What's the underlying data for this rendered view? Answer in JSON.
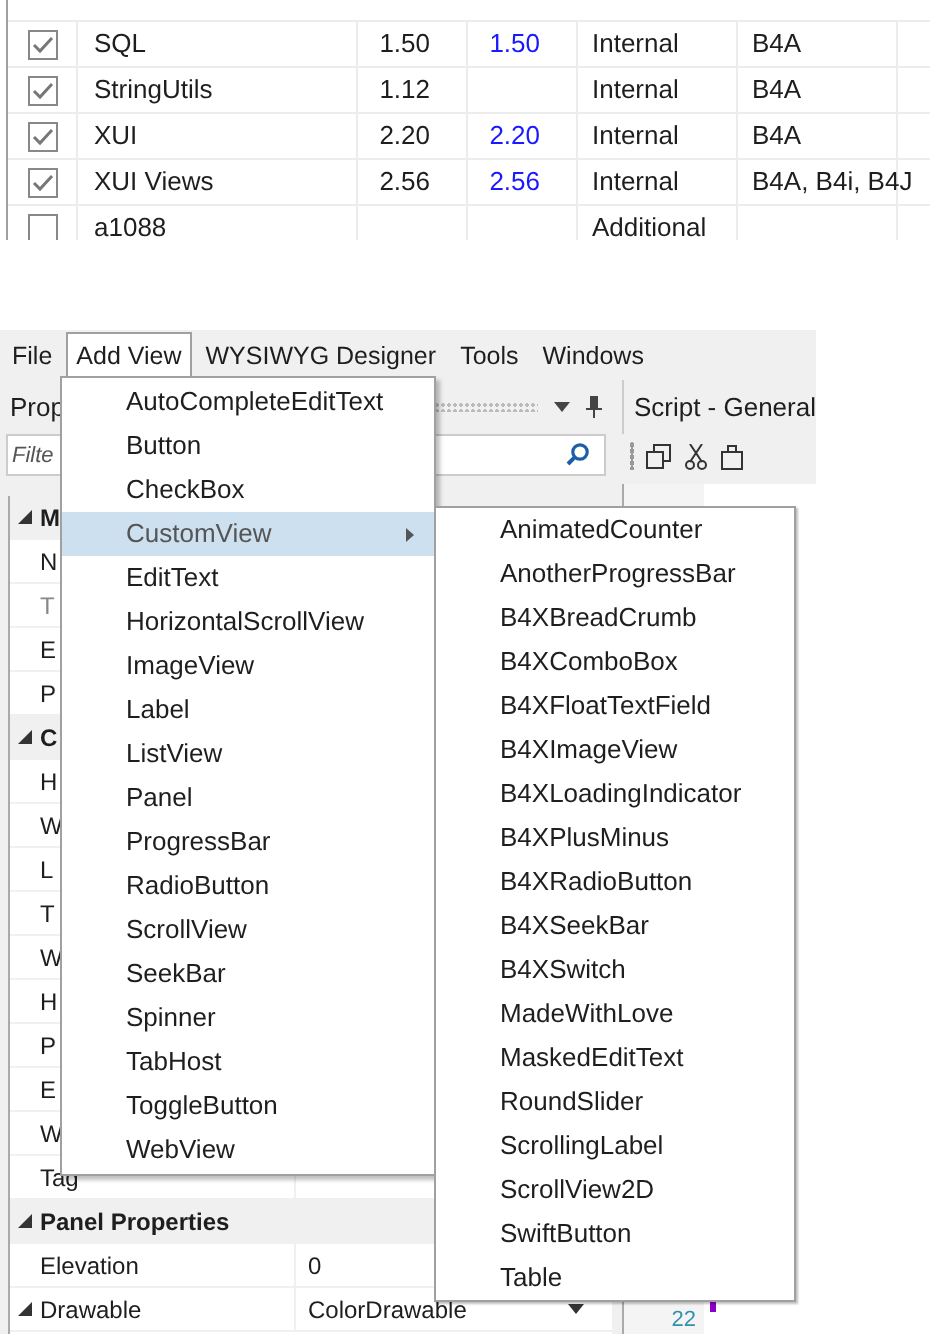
{
  "library_table": {
    "rows": [
      {
        "checked": true,
        "name": "SQL",
        "version": "1.50",
        "online_version": "1.50",
        "type": "Internal",
        "platforms": "B4A"
      },
      {
        "checked": true,
        "name": "StringUtils",
        "version": "1.12",
        "type": "Internal",
        "platforms": "B4A"
      },
      {
        "checked": true,
        "name": "XUI",
        "version": "2.20",
        "online_version": "2.20",
        "type": "Internal",
        "platforms": "B4A"
      },
      {
        "checked": true,
        "name": "XUI Views",
        "version": "2.56",
        "online_version": "2.56",
        "type": "Internal",
        "platforms": "B4A, B4i, B4J"
      },
      {
        "checked": false,
        "name": "a1088",
        "type": "Additional"
      }
    ]
  },
  "menu_bar": [
    {
      "label": "File",
      "selected": false
    },
    {
      "label": "Add View",
      "selected": true
    },
    {
      "label": "WYSIWYG Designer",
      "selected": false
    },
    {
      "label": "Tools",
      "selected": false
    },
    {
      "label": "Windows",
      "selected": false
    }
  ],
  "properties_panel": {
    "title": "Prop",
    "filter_placeholder": "Filte",
    "rows": [
      {
        "kind": "group",
        "name": "M",
        "expanded": true
      },
      {
        "kind": "property",
        "name": "N"
      },
      {
        "kind": "property",
        "name": "T",
        "disabled": true
      },
      {
        "kind": "property",
        "name": "E"
      },
      {
        "kind": "property",
        "name": "P"
      },
      {
        "kind": "group",
        "name": "C",
        "expanded": true
      },
      {
        "kind": "property",
        "name": "H"
      },
      {
        "kind": "property",
        "name": "W"
      },
      {
        "kind": "property",
        "name": "L"
      },
      {
        "kind": "property",
        "name": "T"
      },
      {
        "kind": "property",
        "name": "W"
      },
      {
        "kind": "property",
        "name": "H"
      },
      {
        "kind": "property",
        "name": "P"
      },
      {
        "kind": "property",
        "name": "E"
      },
      {
        "kind": "property",
        "name": "W"
      },
      {
        "kind": "property",
        "name": "Tag"
      },
      {
        "kind": "group",
        "name": "Panel Properties",
        "expanded": true
      },
      {
        "kind": "property",
        "name": "Elevation",
        "value": "0"
      },
      {
        "kind": "dropdown",
        "name": "Drawable",
        "value": "ColorDrawable",
        "expanded": true
      }
    ]
  },
  "script_panel": {
    "title": "Script - General",
    "line_number": "22"
  },
  "add_view_menu": [
    {
      "label": "AutoCompleteEditText",
      "selected": false
    },
    {
      "label": "Button",
      "selected": false
    },
    {
      "label": "CheckBox",
      "selected": false
    },
    {
      "label": "CustomView",
      "selected": true,
      "has_submenu": true
    },
    {
      "label": "EditText",
      "selected": false
    },
    {
      "label": "HorizontalScrollView",
      "selected": false
    },
    {
      "label": "ImageView",
      "selected": false
    },
    {
      "label": "Label",
      "selected": false
    },
    {
      "label": "ListView",
      "selected": false
    },
    {
      "label": "Panel",
      "selected": false
    },
    {
      "label": "ProgressBar",
      "selected": false
    },
    {
      "label": "RadioButton",
      "selected": false
    },
    {
      "label": "ScrollView",
      "selected": false
    },
    {
      "label": "SeekBar",
      "selected": false
    },
    {
      "label": "Spinner",
      "selected": false
    },
    {
      "label": "TabHost",
      "selected": false
    },
    {
      "label": "ToggleButton",
      "selected": false
    },
    {
      "label": "WebView",
      "selected": false
    }
  ],
  "custom_view_submenu": [
    "AnimatedCounter",
    "AnotherProgressBar",
    "B4XBreadCrumb",
    "B4XComboBox",
    "B4XFloatTextField",
    "B4XImageView",
    "B4XLoadingIndicator",
    "B4XPlusMinus",
    "B4XRadioButton",
    "B4XSeekBar",
    "B4XSwitch",
    "MadeWithLove",
    "MaskedEditText",
    "RoundSlider",
    "ScrollingLabel",
    "ScrollView2D",
    "SwiftButton",
    "Table"
  ]
}
